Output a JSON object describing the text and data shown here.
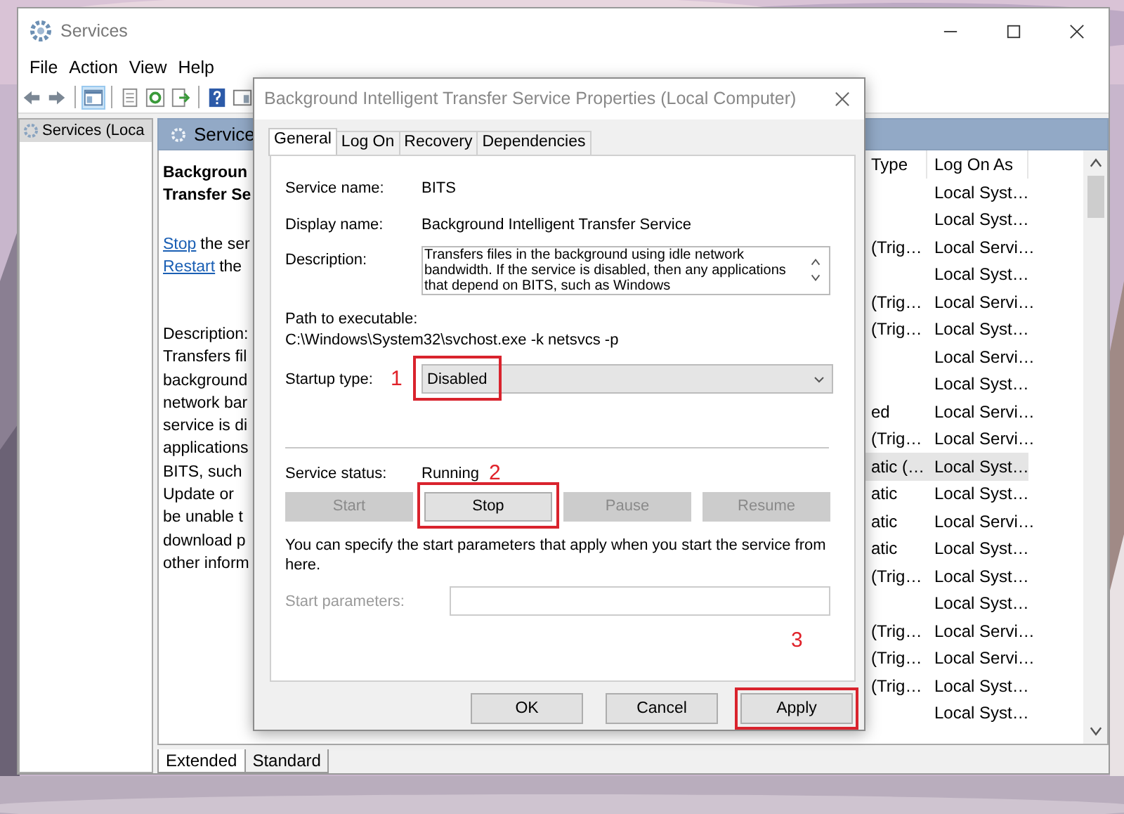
{
  "window": {
    "title": "Services"
  },
  "menu": [
    "File",
    "Action",
    "View",
    "Help"
  ],
  "tree": {
    "items": [
      {
        "label": "Services (Loca",
        "selected": true
      }
    ]
  },
  "detail": {
    "header": "Service",
    "title_lines": [
      "Backgroun",
      "Transfer Se"
    ],
    "actions": [
      {
        "link": "Stop",
        "rest": "the ser"
      },
      {
        "link": "Restart",
        "rest": "the"
      }
    ],
    "description_lines": [
      "Description:",
      "Transfers fil",
      "background",
      "network bar",
      "service is di",
      "applications",
      "BITS, such",
      "Update or",
      "be unable t",
      "download p",
      "other inform"
    ]
  },
  "list": {
    "columns": [
      "Type",
      "Log On As"
    ],
    "rows": [
      {
        "log_on_as": "Local Syst…",
        "selected": false
      },
      {
        "log_on_as": "Local Syst…",
        "selected": false
      },
      {
        "type": "(Trig…",
        "log_on_as": "Local Servi…",
        "selected": false
      },
      {
        "log_on_as": "Local Syst…",
        "selected": false
      },
      {
        "type": "(Trig…",
        "log_on_as": "Local Servi…",
        "selected": false
      },
      {
        "type": "(Trig…",
        "log_on_as": "Local Syst…",
        "selected": false
      },
      {
        "log_on_as": "Local Servi…",
        "selected": false
      },
      {
        "log_on_as": "Local Syst…",
        "selected": false
      },
      {
        "type": "ed",
        "log_on_as": "Local Servi…",
        "selected": false
      },
      {
        "type": "(Trig…",
        "log_on_as": "Local Servi…",
        "selected": false
      },
      {
        "type": "atic (…",
        "log_on_as": "Local Syst…",
        "selected": true
      },
      {
        "type": "atic",
        "log_on_as": "Local Syst…",
        "selected": false
      },
      {
        "type": "atic",
        "log_on_as": "Local Servi…",
        "selected": false
      },
      {
        "type": "atic",
        "log_on_as": "Local Syst…",
        "selected": false
      },
      {
        "type": "(Trig…",
        "log_on_as": "Local Syst…",
        "selected": false
      },
      {
        "log_on_as": "Local Syst…",
        "selected": false
      },
      {
        "type": "(Trig…",
        "log_on_as": "Local Servi…",
        "selected": false
      },
      {
        "type": "(Trig…",
        "log_on_as": "Local Servi…",
        "selected": false
      },
      {
        "type": "(Trig…",
        "log_on_as": "Local Syst…",
        "selected": false
      },
      {
        "log_on_as": "Local Syst…",
        "selected": false
      }
    ]
  },
  "bottom_tabs": [
    {
      "label": "Extended",
      "selected": true
    },
    {
      "label": "Standard",
      "selected": false
    }
  ],
  "dialog": {
    "title": "Background Intelligent Transfer Service Properties (Local Computer)",
    "tabs": [
      {
        "label": "General",
        "selected": true
      },
      {
        "label": "Log On",
        "selected": false
      },
      {
        "label": "Recovery",
        "selected": false
      },
      {
        "label": "Dependencies",
        "selected": false
      }
    ],
    "service_name": {
      "label": "Service name:",
      "value": "BITS"
    },
    "display_name": {
      "label": "Display name:",
      "value": "Background Intelligent Transfer Service"
    },
    "description": {
      "label": "Description:",
      "value": "Transfers files in the background using idle network bandwidth. If the service is disabled, then any applications that depend on BITS, such as Windows"
    },
    "path": {
      "label": "Path to executable:",
      "value": "C:\\Windows\\System32\\svchost.exe -k netsvcs -p"
    },
    "startup_type": {
      "label": "Startup type:",
      "value": "Disabled",
      "marker": "1"
    },
    "status": {
      "label": "Service status:",
      "value": "Running",
      "marker": "2"
    },
    "service_buttons": [
      {
        "label": "Start",
        "disabled": true
      },
      {
        "label": "Stop",
        "disabled": false,
        "marker": true
      },
      {
        "label": "Pause",
        "disabled": true
      },
      {
        "label": "Resume",
        "disabled": true
      }
    ],
    "note": "You can specify the start parameters that apply when you start the service from here.",
    "start_parameters": {
      "label": "Start parameters:",
      "disabled": true
    },
    "footer_marker": "3",
    "footer_buttons": [
      {
        "label": "OK",
        "marked": false
      },
      {
        "label": "Cancel",
        "marked": false
      },
      {
        "label": "Apply",
        "marked": true
      }
    ]
  }
}
